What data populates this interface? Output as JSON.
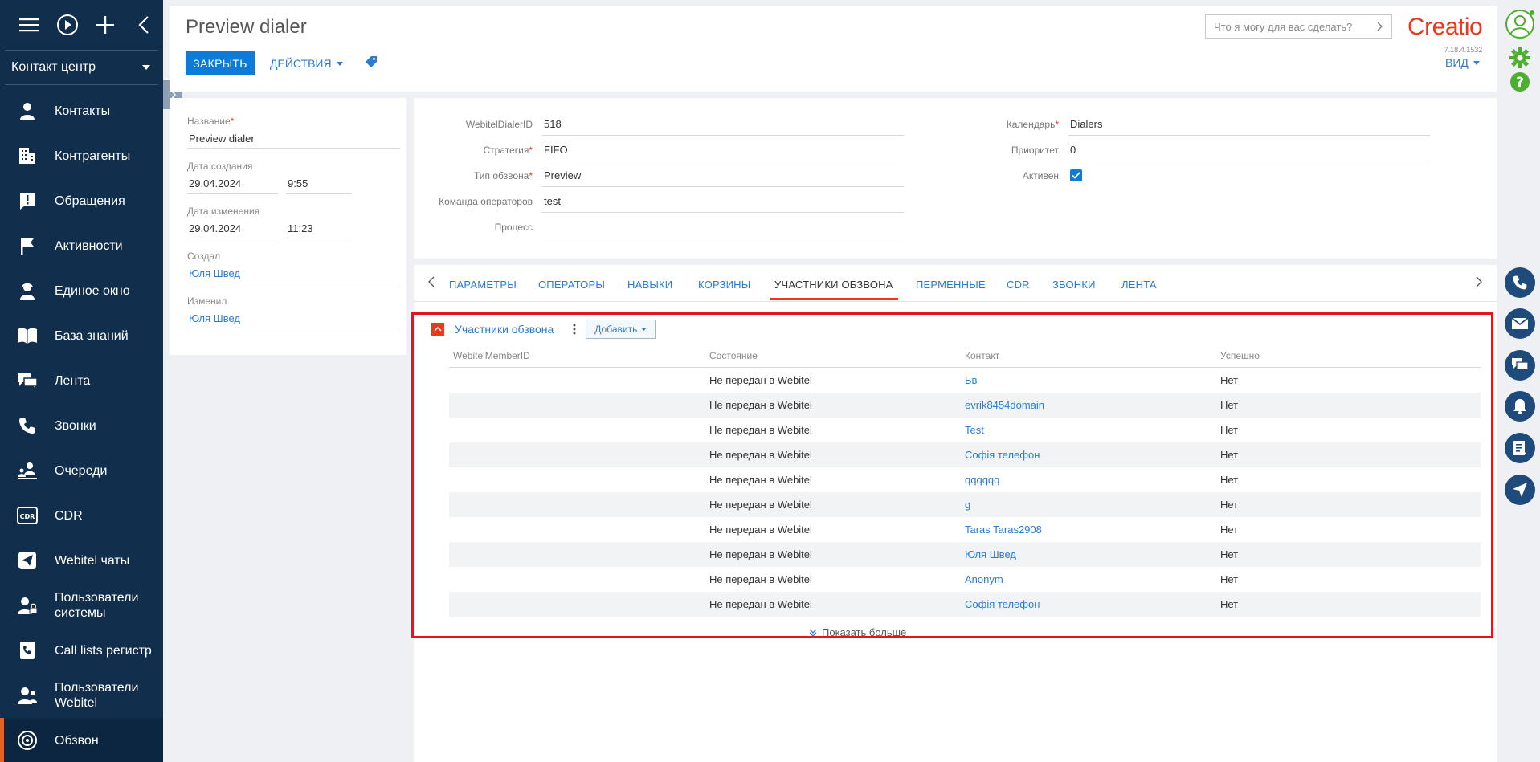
{
  "sidebar": {
    "workplace": "Контакт центр",
    "items": [
      {
        "label": "Контакты",
        "icon": "person-icon"
      },
      {
        "label": "Контрагенты",
        "icon": "building-icon"
      },
      {
        "label": "Обращения",
        "icon": "exclamation-icon"
      },
      {
        "label": "Активности",
        "icon": "flag-icon"
      },
      {
        "label": "Единое окно",
        "icon": "agent-icon"
      },
      {
        "label": "База знаний",
        "icon": "book-icon"
      },
      {
        "label": "Лента",
        "icon": "feed-icon"
      },
      {
        "label": "Звонки",
        "icon": "phone-icon"
      },
      {
        "label": "Очереди",
        "icon": "queue-icon"
      },
      {
        "label": "CDR",
        "icon": "cdr-icon"
      },
      {
        "label": "Webitel чаты",
        "icon": "paper-plane-icon"
      },
      {
        "label": "Пользователи системы",
        "icon": "user-lock-icon"
      },
      {
        "label": "Call lists регистр",
        "icon": "phone-list-icon"
      },
      {
        "label": "Пользователи Webitel",
        "icon": "users-icon"
      },
      {
        "label": "Обзвон",
        "icon": "dialer-icon"
      }
    ]
  },
  "header": {
    "title": "Preview dialer",
    "close_label": "ЗАКРЫТЬ",
    "actions_label": "ДЕЙСТВИЯ",
    "search_placeholder": "Что я могу для вас сделать?",
    "logo": "Creatio",
    "version": "7.18.4.1532",
    "view_label": "ВИД"
  },
  "info": {
    "name_label": "Название",
    "name_value": "Preview dialer",
    "created_label": "Дата создания",
    "created_date": "29.04.2024",
    "created_time": "9:55",
    "modified_label": "Дата изменения",
    "modified_date": "29.04.2024",
    "modified_time": "11:23",
    "created_by_label": "Создал",
    "created_by": "Юля Швед",
    "modified_by_label": "Изменил",
    "modified_by": "Юля Швед"
  },
  "form": {
    "dialer_id_label": "WebitelDialerID",
    "dialer_id": "518",
    "strategy_label": "Стратегия",
    "strategy": "FIFO",
    "type_label": "Тип обзвона",
    "type": "Preview",
    "team_label": "Команда операторов",
    "team": "test",
    "process_label": "Процесс",
    "process": "",
    "calendar_label": "Календарь",
    "calendar": "Dialers",
    "priority_label": "Приоритет",
    "priority": "0",
    "active_label": "Активен",
    "active": true
  },
  "tabs": [
    "ПАРАМЕТРЫ",
    "ОПЕРАТОРЫ",
    "НАВЫКИ",
    "КОРЗИНЫ",
    "УЧАСТНИКИ ОБЗВОНА",
    "ПЕРМЕННЫЕ",
    "CDR",
    "ЗВОНКИ",
    "ЛЕНТА"
  ],
  "active_tab": "УЧАСТНИКИ ОБЗВОНА",
  "detail": {
    "title": "Участники обзвона",
    "add_label": "Добавить",
    "columns": [
      "WebitelMemberID",
      "Состояние",
      "Контакт",
      "Успешно"
    ],
    "rows": [
      [
        "",
        "Не передан в Webitel",
        "Ьв",
        "Нет"
      ],
      [
        "",
        "Не передан в Webitel",
        "evrik8454domain",
        "Нет"
      ],
      [
        "",
        "Не передан в Webitel",
        "Test",
        "Нет"
      ],
      [
        "",
        "Не передан в Webitel",
        "Софія телефон",
        "Нет"
      ],
      [
        "",
        "Не передан в Webitel",
        "qqqqqq",
        "Нет"
      ],
      [
        "",
        "Не передан в Webitel",
        "g",
        "Нет"
      ],
      [
        "",
        "Не передан в Webitel",
        "Taras Taras2908",
        "Нет"
      ],
      [
        "",
        "Не передан в Webitel",
        "Юля Швед",
        "Нет"
      ],
      [
        "",
        "Не передан в Webitel",
        "Anonym",
        "Нет"
      ],
      [
        "",
        "Не передан в Webitel",
        "Софія телефон",
        "Нет"
      ]
    ],
    "show_more": "Показать больше"
  },
  "colors": {
    "sidebar_bg": "#122e4d",
    "accent_blue": "#0e7bd8",
    "brand_red": "#e8381d",
    "link_blue": "#2b7bd3",
    "highlight_red": "#e5141a",
    "right_icon_bg": "#1f4b7c",
    "settings_green": "#4cae2f"
  }
}
